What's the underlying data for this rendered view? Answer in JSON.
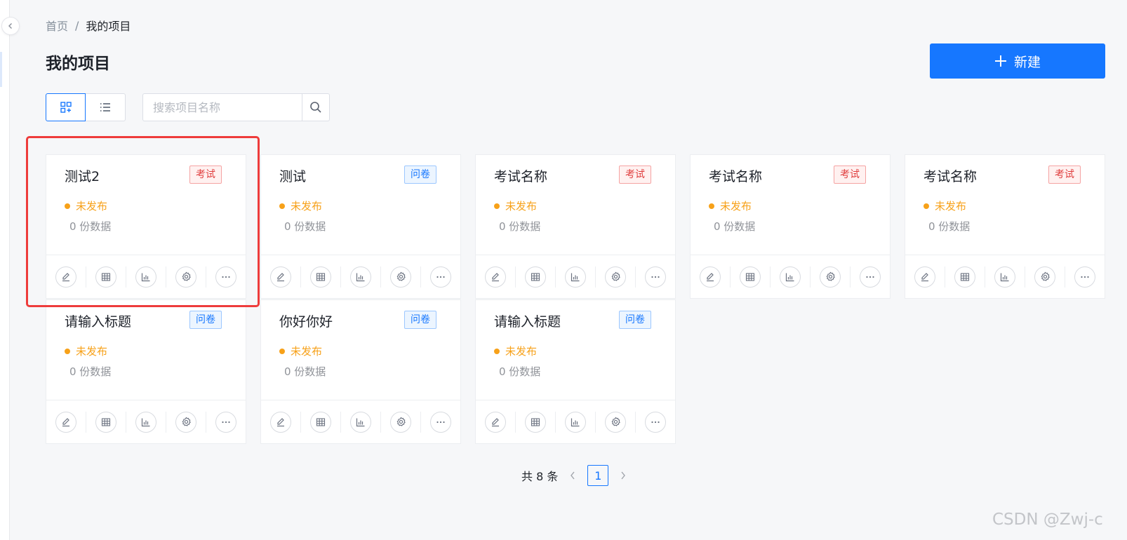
{
  "breadcrumb": {
    "home": "首页",
    "separator": "/",
    "current": "我的项目"
  },
  "page": {
    "title": "我的项目"
  },
  "toolbar": {
    "new_label": "新建"
  },
  "search": {
    "placeholder": "搜索项目名称",
    "value": ""
  },
  "view": {
    "active": "grid"
  },
  "colors": {
    "accent": "#1677ff",
    "status_unpublished": "#f7a119",
    "tag_exam": "#e03e3e",
    "tag_survey": "#1677ff",
    "highlight": "#ee3c3c"
  },
  "projects": [
    {
      "title": "测试2",
      "tag": "考试",
      "tag_type": "exam",
      "status": "未发布",
      "count": "0  份数据"
    },
    {
      "title": "测试",
      "tag": "问卷",
      "tag_type": "survey",
      "status": "未发布",
      "count": "0  份数据"
    },
    {
      "title": "考试名称",
      "tag": "考试",
      "tag_type": "exam",
      "status": "未发布",
      "count": "0  份数据"
    },
    {
      "title": "考试名称",
      "tag": "考试",
      "tag_type": "exam",
      "status": "未发布",
      "count": "0  份数据"
    },
    {
      "title": "考试名称",
      "tag": "考试",
      "tag_type": "exam",
      "status": "未发布",
      "count": "0  份数据"
    },
    {
      "title": "请输入标题",
      "tag": "问卷",
      "tag_type": "survey",
      "status": "未发布",
      "count": "0  份数据"
    },
    {
      "title": "你好你好",
      "tag": "问卷",
      "tag_type": "survey",
      "status": "未发布",
      "count": "0  份数据"
    },
    {
      "title": "请输入标题",
      "tag": "问卷",
      "tag_type": "survey",
      "status": "未发布",
      "count": "0  份数据"
    }
  ],
  "card_actions": [
    {
      "name": "edit",
      "icon": "edit-icon"
    },
    {
      "name": "data-table",
      "icon": "table-icon"
    },
    {
      "name": "statistics",
      "icon": "bar-chart-icon"
    },
    {
      "name": "settings",
      "icon": "gear-icon"
    },
    {
      "name": "more",
      "icon": "more-icon"
    }
  ],
  "pagination": {
    "total_label": "共 8 条",
    "current_page": "1"
  },
  "watermark": "CSDN @Zwj-c"
}
